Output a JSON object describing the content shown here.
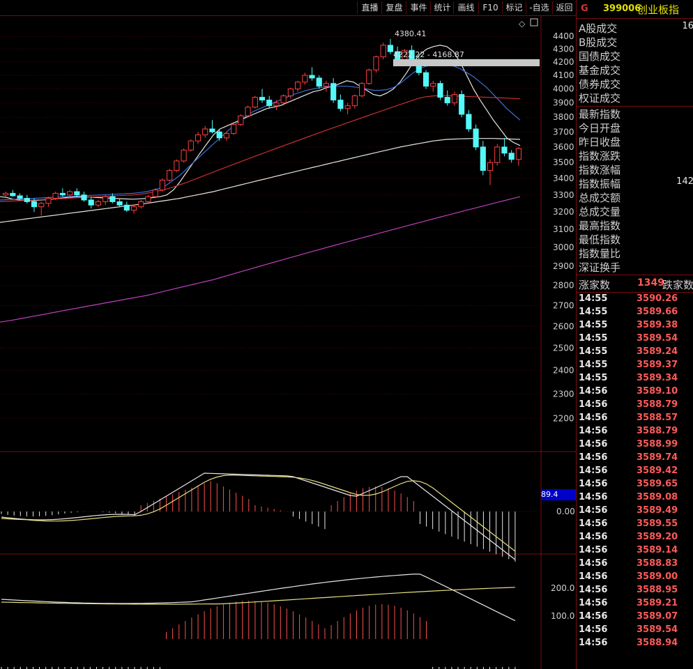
{
  "toolbar": {
    "buttons": [
      "直播",
      "复盘",
      "事件",
      "统计",
      "画线",
      "F10",
      "标记",
      "-自选",
      "返回"
    ]
  },
  "chart_data": {
    "type": "candlestick",
    "title": "",
    "y_axis_main": {
      "ticks": [
        4400,
        4300,
        4200,
        4100,
        4000,
        3900,
        3800,
        3700,
        3600,
        3500,
        3400,
        3300,
        3200,
        3100,
        3000,
        2900,
        2800,
        2700,
        2600,
        2500,
        2400,
        2300,
        2200
      ],
      "scale": "log"
    },
    "annotations": {
      "high_label": "4380.41",
      "range_label": "4222.22 - 4168.87"
    },
    "ma_series": [
      {
        "color": "#e8e8e8",
        "values": [
          3290,
          3285,
          3275,
          3270,
          3268,
          3266,
          3270,
          3272,
          3275,
          3280,
          3285,
          3288,
          3290,
          3288,
          3286,
          3284,
          3282,
          3280,
          3278,
          3276,
          3275,
          3277,
          3280,
          3285,
          3290,
          3300,
          3330,
          3380,
          3440,
          3500,
          3560,
          3620,
          3680,
          3720,
          3740,
          3760,
          3780,
          3800,
          3820,
          3840,
          3860,
          3870,
          3880,
          3900,
          3920,
          3940,
          3960,
          3980,
          3990,
          4010,
          4020,
          4040,
          4060,
          4050,
          4020,
          3990,
          3960,
          3950,
          3970,
          4000,
          4050,
          4120,
          4200,
          4260,
          4300,
          4320,
          4330,
          4320,
          4280,
          4200,
          4100,
          4000,
          3920,
          3850,
          3780,
          3720,
          3660,
          3630,
          3610
        ]
      },
      {
        "color": "#3a6fd8",
        "values": [
          3270,
          3272,
          3274,
          3276,
          3278,
          3280,
          3282,
          3284,
          3286,
          3288,
          3290,
          3292,
          3294,
          3296,
          3298,
          3300,
          3302,
          3304,
          3306,
          3308,
          3310,
          3315,
          3320,
          3330,
          3340,
          3360,
          3390,
          3420,
          3460,
          3500,
          3540,
          3580,
          3620,
          3660,
          3700,
          3740,
          3780,
          3810,
          3840,
          3860,
          3880,
          3900,
          3920,
          3940,
          3960,
          3975,
          3990,
          4000,
          4010,
          4015,
          4020,
          4020,
          4020,
          4015,
          4010,
          4000,
          3990,
          3990,
          3995,
          4010,
          4040,
          4080,
          4120,
          4150,
          4170,
          4180,
          4185,
          4180,
          4170,
          4150,
          4120,
          4090,
          4050,
          4010,
          3960,
          3910,
          3860,
          3820,
          3780
        ]
      },
      {
        "color": "#c83030",
        "values": [
          3260,
          3262,
          3264,
          3266,
          3268,
          3270,
          3272,
          3274,
          3276,
          3278,
          3280,
          3282,
          3284,
          3286,
          3288,
          3290,
          3292,
          3294,
          3296,
          3298,
          3300,
          3305,
          3310,
          3318,
          3326,
          3336,
          3348,
          3362,
          3376,
          3392,
          3408,
          3424,
          3440,
          3456,
          3472,
          3488,
          3504,
          3520,
          3536,
          3552,
          3568,
          3584,
          3600,
          3616,
          3632,
          3648,
          3664,
          3680,
          3696,
          3712,
          3728,
          3744,
          3760,
          3776,
          3792,
          3808,
          3824,
          3840,
          3856,
          3872,
          3888,
          3904,
          3920,
          3935,
          3945,
          3950,
          3952,
          3952,
          3950,
          3948,
          3946,
          3944,
          3942,
          3940,
          3938,
          3936,
          3934,
          3932,
          3930
        ]
      },
      {
        "color": "#e8e8e0",
        "values": [
          3140,
          3145,
          3150,
          3155,
          3160,
          3165,
          3170,
          3175,
          3180,
          3185,
          3190,
          3195,
          3200,
          3205,
          3210,
          3215,
          3220,
          3225,
          3230,
          3235,
          3240,
          3245,
          3250,
          3256,
          3262,
          3268,
          3274,
          3280,
          3288,
          3296,
          3304,
          3312,
          3320,
          3330,
          3340,
          3350,
          3360,
          3370,
          3380,
          3390,
          3400,
          3410,
          3420,
          3430,
          3440,
          3450,
          3460,
          3470,
          3480,
          3490,
          3500,
          3510,
          3520,
          3530,
          3540,
          3550,
          3560,
          3570,
          3580,
          3590,
          3600,
          3608,
          3616,
          3624,
          3632,
          3640,
          3645,
          3650,
          3652,
          3654,
          3655,
          3656,
          3656,
          3656,
          3656,
          3655,
          3654,
          3652,
          3650
        ]
      },
      {
        "color": "#c040c0",
        "values": [
          2620,
          2625,
          2630,
          2636,
          2642,
          2648,
          2654,
          2660,
          2666,
          2672,
          2678,
          2684,
          2690,
          2696,
          2702,
          2708,
          2714,
          2720,
          2726,
          2732,
          2738,
          2744,
          2750,
          2758,
          2766,
          2774,
          2782,
          2790,
          2798,
          2806,
          2814,
          2822,
          2830,
          2840,
          2850,
          2860,
          2870,
          2880,
          2890,
          2900,
          2910,
          2920,
          2930,
          2940,
          2950,
          2960,
          2970,
          2980,
          2990,
          3000,
          3010,
          3020,
          3030,
          3040,
          3050,
          3060,
          3070,
          3080,
          3090,
          3100,
          3110,
          3120,
          3130,
          3140,
          3150,
          3160,
          3170,
          3180,
          3190,
          3200,
          3210,
          3220,
          3230,
          3240,
          3250,
          3260,
          3270,
          3280,
          3290
        ]
      }
    ],
    "candles": [
      [
        3300,
        3320,
        3280,
        3310
      ],
      [
        3310,
        3330,
        3290,
        3295
      ],
      [
        3295,
        3310,
        3270,
        3280
      ],
      [
        3280,
        3300,
        3250,
        3260
      ],
      [
        3260,
        3280,
        3200,
        3230
      ],
      [
        3230,
        3260,
        3180,
        3250
      ],
      [
        3250,
        3290,
        3230,
        3280
      ],
      [
        3280,
        3320,
        3270,
        3310
      ],
      [
        3310,
        3340,
        3290,
        3300
      ],
      [
        3300,
        3330,
        3280,
        3320
      ],
      [
        3320,
        3340,
        3290,
        3300
      ],
      [
        3300,
        3320,
        3260,
        3270
      ],
      [
        3270,
        3290,
        3220,
        3240
      ],
      [
        3240,
        3270,
        3230,
        3260
      ],
      [
        3260,
        3300,
        3240,
        3290
      ],
      [
        3290,
        3310,
        3250,
        3260
      ],
      [
        3260,
        3280,
        3230,
        3240
      ],
      [
        3240,
        3260,
        3200,
        3210
      ],
      [
        3210,
        3240,
        3190,
        3230
      ],
      [
        3230,
        3270,
        3220,
        3260
      ],
      [
        3260,
        3300,
        3250,
        3290
      ],
      [
        3290,
        3340,
        3280,
        3330
      ],
      [
        3330,
        3400,
        3320,
        3390
      ],
      [
        3390,
        3460,
        3380,
        3450
      ],
      [
        3450,
        3520,
        3440,
        3510
      ],
      [
        3510,
        3590,
        3500,
        3580
      ],
      [
        3580,
        3650,
        3570,
        3640
      ],
      [
        3640,
        3700,
        3620,
        3680
      ],
      [
        3680,
        3740,
        3660,
        3720
      ],
      [
        3720,
        3780,
        3690,
        3700
      ],
      [
        3700,
        3720,
        3640,
        3660
      ],
      [
        3660,
        3700,
        3640,
        3690
      ],
      [
        3690,
        3760,
        3680,
        3750
      ],
      [
        3750,
        3820,
        3740,
        3810
      ],
      [
        3810,
        3880,
        3800,
        3870
      ],
      [
        3870,
        3950,
        3860,
        3940
      ],
      [
        3940,
        4000,
        3900,
        3920
      ],
      [
        3920,
        3950,
        3860,
        3880
      ],
      [
        3880,
        3920,
        3850,
        3900
      ],
      [
        3900,
        3960,
        3880,
        3950
      ],
      [
        3950,
        4010,
        3930,
        4000
      ],
      [
        4000,
        4060,
        3980,
        4050
      ],
      [
        4050,
        4120,
        4030,
        4100
      ],
      [
        4100,
        4160,
        4060,
        4080
      ],
      [
        4080,
        4100,
        4000,
        4020
      ],
      [
        4020,
        4060,
        3980,
        4040
      ],
      [
        4040,
        4080,
        3900,
        3920
      ],
      [
        3920,
        3960,
        3840,
        3860
      ],
      [
        3860,
        3900,
        3820,
        3880
      ],
      [
        3880,
        3960,
        3860,
        3950
      ],
      [
        3950,
        4050,
        3940,
        4040
      ],
      [
        4040,
        4150,
        4030,
        4140
      ],
      [
        4140,
        4250,
        4120,
        4240
      ],
      [
        4240,
        4350,
        4220,
        4330
      ],
      [
        4330,
        4380,
        4260,
        4280
      ],
      [
        4280,
        4320,
        4180,
        4200
      ],
      [
        4200,
        4300,
        4190,
        4290
      ],
      [
        4290,
        4330,
        4200,
        4220
      ],
      [
        4220,
        4240,
        4100,
        4120
      ],
      [
        4120,
        4140,
        4000,
        4020
      ],
      [
        4020,
        4060,
        3980,
        4040
      ],
      [
        4040,
        4060,
        3920,
        3940
      ],
      [
        3940,
        3990,
        3880,
        3900
      ],
      [
        3900,
        3980,
        3880,
        3960
      ],
      [
        3960,
        3990,
        3800,
        3820
      ],
      [
        3820,
        3850,
        3700,
        3720
      ],
      [
        3720,
        3750,
        3580,
        3600
      ],
      [
        3600,
        3640,
        3420,
        3450
      ],
      [
        3450,
        3520,
        3360,
        3500
      ],
      [
        3500,
        3620,
        3480,
        3600
      ],
      [
        3600,
        3660,
        3540,
        3560
      ],
      [
        3560,
        3580,
        3500,
        3520
      ],
      [
        3520,
        3600,
        3480,
        3590
      ]
    ],
    "macd_label": "89.4",
    "macd_zero_label": "0.00",
    "kdj_labels": [
      "200.0",
      "100.0"
    ]
  },
  "right_panel": {
    "flag": "G",
    "code": "399006",
    "name": "创业板指",
    "rows": [
      {
        "label": "A股成交",
        "value": "16"
      },
      {
        "label": "B股成交",
        "value": ""
      },
      {
        "label": "国债成交",
        "value": ""
      },
      {
        "label": "基金成交",
        "value": ""
      },
      {
        "label": "债券成交",
        "value": ""
      },
      {
        "label": "权证成交",
        "value": ""
      }
    ],
    "rows2": [
      {
        "label": "最新指数",
        "value": ""
      },
      {
        "label": "今日开盘",
        "value": ""
      },
      {
        "label": "昨日收盘",
        "value": ""
      },
      {
        "label": "指数涨跌",
        "value": ""
      },
      {
        "label": "指数涨幅",
        "value": ""
      },
      {
        "label": "指数振幅",
        "value": "142"
      },
      {
        "label": "总成交额",
        "value": ""
      },
      {
        "label": "总成交量",
        "value": ""
      },
      {
        "label": "最高指数",
        "value": ""
      },
      {
        "label": "最低指数",
        "value": ""
      },
      {
        "label": "指数量比",
        "value": ""
      },
      {
        "label": "深证换手",
        "value": ""
      }
    ],
    "updown": {
      "up_label": "涨家数",
      "up_value": "1349",
      "down_label": "跌家数"
    },
    "ticks": [
      {
        "time": "14:55",
        "price": "3590.26"
      },
      {
        "time": "14:55",
        "price": "3589.66"
      },
      {
        "time": "14:55",
        "price": "3589.38"
      },
      {
        "time": "14:55",
        "price": "3589.54"
      },
      {
        "time": "14:55",
        "price": "3589.24"
      },
      {
        "time": "14:55",
        "price": "3589.37"
      },
      {
        "time": "14:55",
        "price": "3589.34"
      },
      {
        "time": "14:56",
        "price": "3589.10"
      },
      {
        "time": "14:56",
        "price": "3588.79"
      },
      {
        "time": "14:56",
        "price": "3588.57"
      },
      {
        "time": "14:56",
        "price": "3588.79"
      },
      {
        "time": "14:56",
        "price": "3588.99"
      },
      {
        "time": "14:56",
        "price": "3589.74"
      },
      {
        "time": "14:56",
        "price": "3589.42"
      },
      {
        "time": "14:56",
        "price": "3589.65"
      },
      {
        "time": "14:56",
        "price": "3589.08"
      },
      {
        "time": "14:56",
        "price": "3589.49"
      },
      {
        "time": "14:56",
        "price": "3589.55"
      },
      {
        "time": "14:56",
        "price": "3589.20"
      },
      {
        "time": "14:56",
        "price": "3589.14"
      },
      {
        "time": "14:56",
        "price": "3588.83"
      },
      {
        "time": "14:56",
        "price": "3589.00"
      },
      {
        "time": "14:56",
        "price": "3588.95"
      },
      {
        "time": "14:56",
        "price": "3589.21"
      },
      {
        "time": "14:56",
        "price": "3589.07"
      },
      {
        "time": "14:56",
        "price": "3589.54"
      },
      {
        "time": "14:56",
        "price": "3588.94"
      }
    ]
  }
}
